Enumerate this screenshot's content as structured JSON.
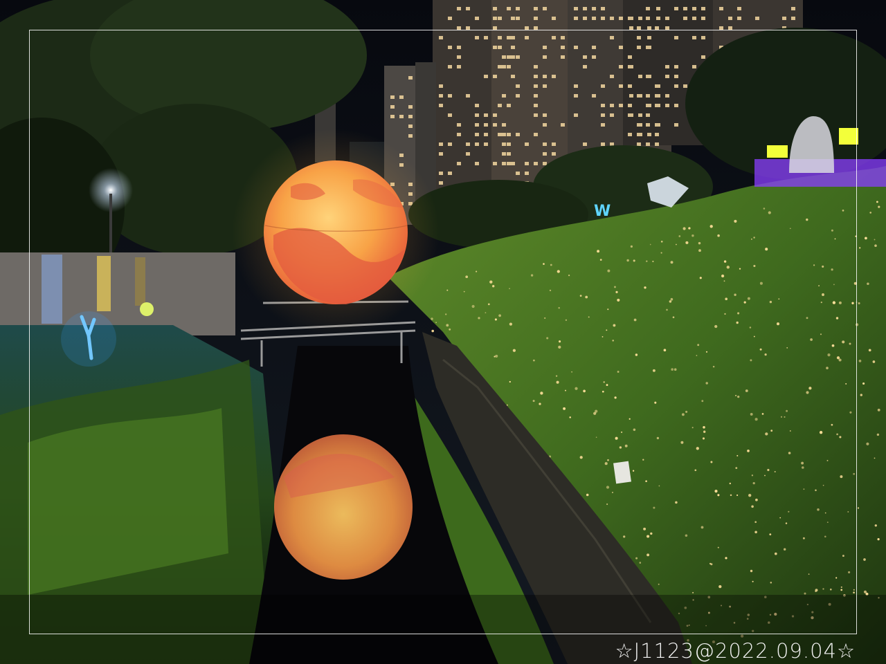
{
  "photo": {
    "watermark": "☆J1123@2022.09.04☆"
  },
  "colors": {
    "sky": "#0a0d14",
    "moon_light": "#ffc866",
    "moon_dark": "#e8603a",
    "grass": "#3e6a1f",
    "water": "#080806",
    "fairy_lights": "#ffd98a",
    "neon_purple": "#9b4dff",
    "neon_blue": "#4aa8ff",
    "frame_line": "#ffffff"
  }
}
